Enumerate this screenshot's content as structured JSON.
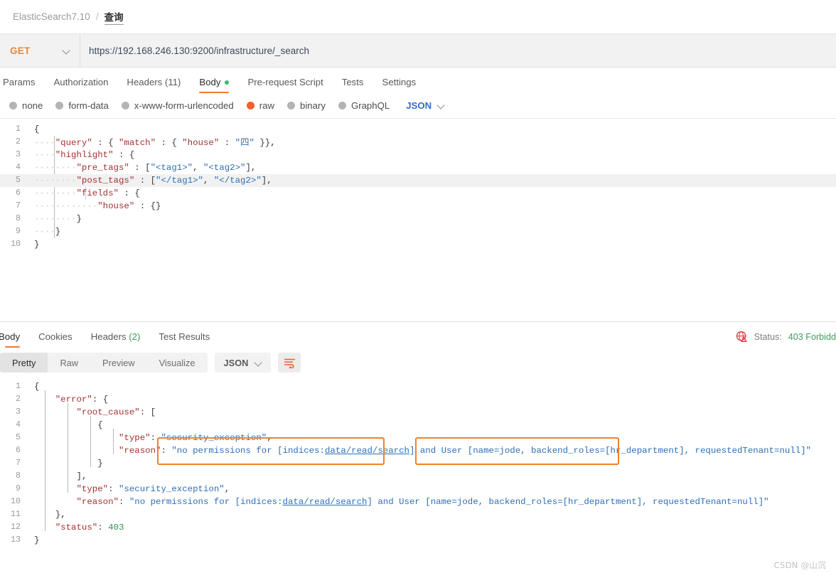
{
  "breadcrumb": {
    "root": "ElasticSearch7.10",
    "separator": "/",
    "current": "查询"
  },
  "request": {
    "method": "GET",
    "url": "https://192.168.246.130:9200/infrastructure/_search",
    "tabs": [
      {
        "label": "Params",
        "active": false,
        "dot": false
      },
      {
        "label": "Authorization",
        "active": false,
        "dot": false
      },
      {
        "label": "Headers (11)",
        "active": false,
        "dot": false
      },
      {
        "label": "Body",
        "active": true,
        "dot": true
      },
      {
        "label": "Pre-request Script",
        "active": false,
        "dot": false
      },
      {
        "label": "Tests",
        "active": false,
        "dot": false
      },
      {
        "label": "Settings",
        "active": false,
        "dot": false
      }
    ],
    "body_types": [
      {
        "label": "none",
        "selected": false
      },
      {
        "label": "form-data",
        "selected": false
      },
      {
        "label": "x-www-form-urlencoded",
        "selected": false
      },
      {
        "label": "raw",
        "selected": true
      },
      {
        "label": "binary",
        "selected": false
      },
      {
        "label": "GraphQL",
        "selected": false
      }
    ],
    "format_selected": "JSON",
    "body_lines": [
      {
        "n": 1,
        "text": "{"
      },
      {
        "n": 2,
        "text": "    \"query\" : { \"match\" : { \"house\" : \"四\" }},"
      },
      {
        "n": 3,
        "text": "    \"highlight\" : {"
      },
      {
        "n": 4,
        "text": "        \"pre_tags\" : [\"<tag1>\", \"<tag2>\"],"
      },
      {
        "n": 5,
        "text": "        \"post_tags\" : [\"</tag1>\", \"</tag2>\"],"
      },
      {
        "n": 6,
        "text": "        \"fields\" : {"
      },
      {
        "n": 7,
        "text": "            \"house\" : {}"
      },
      {
        "n": 8,
        "text": "        }"
      },
      {
        "n": 9,
        "text": "    }"
      },
      {
        "n": 10,
        "text": "}"
      }
    ]
  },
  "response": {
    "tabs": [
      {
        "label": "Body",
        "active": true
      },
      {
        "label": "Cookies",
        "active": false
      },
      {
        "label": "Headers (2)",
        "active": false
      },
      {
        "label": "Test Results",
        "active": false
      }
    ],
    "status_label": "Status:",
    "status_value": "403 Forbidd",
    "view_modes": [
      {
        "label": "Pretty",
        "active": true
      },
      {
        "label": "Raw",
        "active": false
      },
      {
        "label": "Preview",
        "active": false
      },
      {
        "label": "Visualize",
        "active": false
      }
    ],
    "format_selected": "JSON",
    "body_lines": [
      {
        "n": 1,
        "text": "{"
      },
      {
        "n": 2,
        "text": "    \"error\": {"
      },
      {
        "n": 3,
        "text": "        \"root_cause\": ["
      },
      {
        "n": 4,
        "text": "            {"
      },
      {
        "n": 5,
        "text": "                \"type\": \"security_exception\","
      },
      {
        "n": 6,
        "text": "                \"reason\": \"no permissions for [indices:data/read/search] and User [name=jode, backend_roles=[hr_department], requestedTenant=null]\""
      },
      {
        "n": 7,
        "text": "            }"
      },
      {
        "n": 8,
        "text": "        ],"
      },
      {
        "n": 9,
        "text": "        \"type\": \"security_exception\","
      },
      {
        "n": 10,
        "text": "        \"reason\": \"no permissions for [indices:data/read/search] and User [name=jode, backend_roles=[hr_department], requestedTenant=null]\""
      },
      {
        "n": 11,
        "text": "    },"
      },
      {
        "n": 12,
        "text": "    \"status\": 403"
      },
      {
        "n": 13,
        "text": "}"
      }
    ],
    "annotations": [
      {
        "label": "permission-highlight-box",
        "note": "no permissions for [indices:data/read/search]"
      },
      {
        "label": "user-highlight-box",
        "note": "[name=jode, backend_roles=[hr_department],"
      }
    ]
  },
  "watermark": "CSDN @山沉",
  "colors": {
    "accent_orange": "#f2783b",
    "method_orange": "#e8873b",
    "radio_selected": "#f2612c",
    "link_blue": "#2f6fd0",
    "status_green": "#3e9c5a",
    "annotation_box": "#f0802a"
  }
}
